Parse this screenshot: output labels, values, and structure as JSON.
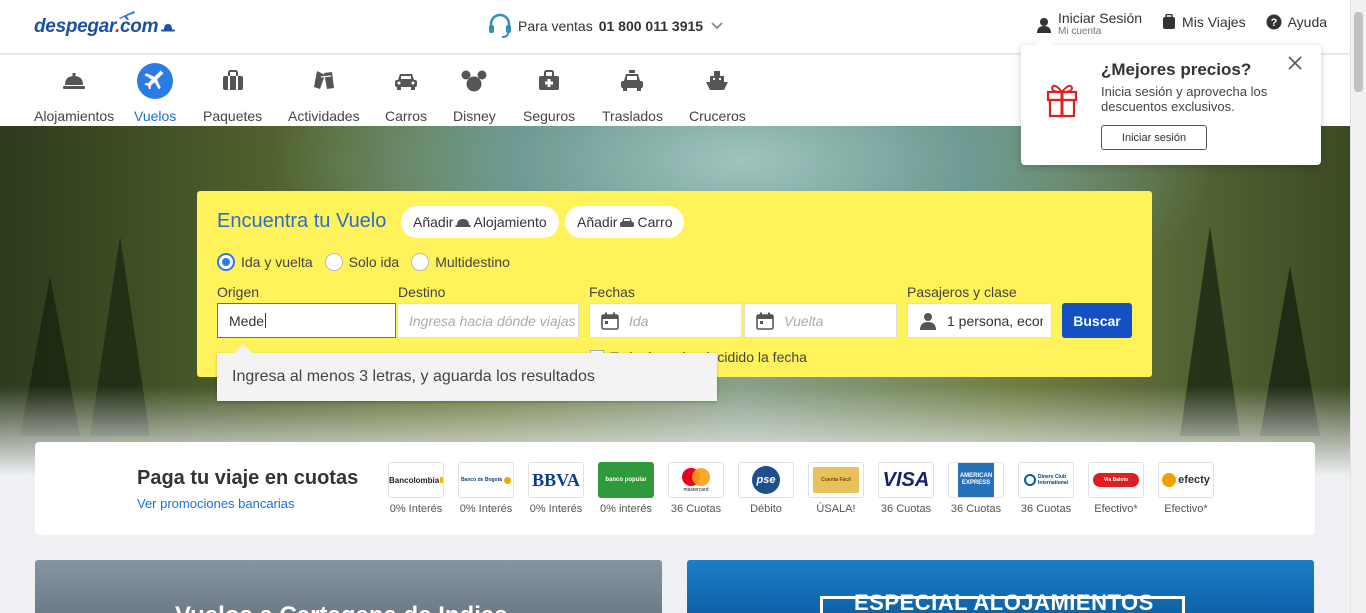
{
  "header": {
    "logo": {
      "pre": "despegar",
      "dot": ".",
      "post": "com"
    },
    "sales_label": "Para ventas",
    "sales_phone": "01 800 011 3915",
    "login_label": "Iniciar Sesión",
    "login_sub": "Mi cuenta",
    "trips_label": "Mis Viajes",
    "help_label": "Ayuda"
  },
  "products": [
    {
      "label": "Alojamientos",
      "icon": "hotel-icon"
    },
    {
      "label": "Vuelos",
      "icon": "plane-icon",
      "active": true
    },
    {
      "label": "Paquetes",
      "icon": "suitcase-icon"
    },
    {
      "label": "Actividades",
      "icon": "activities-icon"
    },
    {
      "label": "Carros",
      "icon": "car-icon"
    },
    {
      "label": "Disney",
      "icon": "mickey-icon"
    },
    {
      "label": "Seguros",
      "icon": "insurance-icon"
    },
    {
      "label": "Traslados",
      "icon": "taxi-icon"
    },
    {
      "label": "Cruceros",
      "icon": "ship-icon"
    }
  ],
  "search": {
    "title": "Encuentra tu Vuelo",
    "add_hotel": "Añadir",
    "add_hotel_label": "Alojamiento",
    "add_car": "Añadir",
    "add_car_label": "Carro",
    "trip_types": [
      "Ida y vuelta",
      "Solo ida",
      "Multidestino"
    ],
    "selected_trip_type": "Ida y vuelta",
    "origin_label": "Origen",
    "origin_value": "Mede",
    "destination_label": "Destino",
    "destination_placeholder": "Ingresa hacia dónde viajas",
    "dates_label": "Fechas",
    "depart_placeholder": "Ida",
    "return_placeholder": "Vuelta",
    "passengers_label": "Pasajeros y clase",
    "passengers_value": "1 persona, econ",
    "search_button": "Buscar",
    "undecided_date": "Todavía no he decidido la fecha",
    "tooltip": "Ingresa al menos 3 letras, y aguarda los resultados"
  },
  "login_popup": {
    "title": "¿Mejores precios?",
    "description": "Inicia sesión y aprovecha los descuentos exclusivos.",
    "button": "Iniciar sesión"
  },
  "payment": {
    "title": "Paga tu viaje en cuotas",
    "link": "Ver promociones bancarias",
    "banks": [
      {
        "name": "Bancolombia",
        "caption": "0% Interés"
      },
      {
        "name": "Banco de Bogotá",
        "caption": "0% Interés"
      },
      {
        "name": "BBVA",
        "caption": "0% Interés"
      },
      {
        "name": "banco popular",
        "caption": "0% interés"
      },
      {
        "name": "mastercard",
        "caption": "36 Cuotas"
      },
      {
        "name": "pse",
        "caption": "Débito"
      },
      {
        "name": "Cuenta Fácil",
        "caption": "ÚSALA!"
      },
      {
        "name": "VISA",
        "caption": "36 Cuotas"
      },
      {
        "name": "AMERICAN EXPRESS",
        "caption": "36 Cuotas"
      },
      {
        "name": "Diners Club International",
        "caption": "36 Cuotas"
      },
      {
        "name": "Via Baloto",
        "caption": "Efectivo*"
      },
      {
        "name": "efecty",
        "caption": "Efectivo*"
      }
    ]
  },
  "promos": [
    {
      "text": "Vuelos a Cartagena de Indias"
    },
    {
      "text": "ESPECIAL ALOJAMIENTOS"
    }
  ],
  "colors": {
    "brand_blue": "#1d4fa3",
    "search_yellow": "#fff25a",
    "primary_button": "#1350c2",
    "accent_blue": "#2a7be4"
  }
}
